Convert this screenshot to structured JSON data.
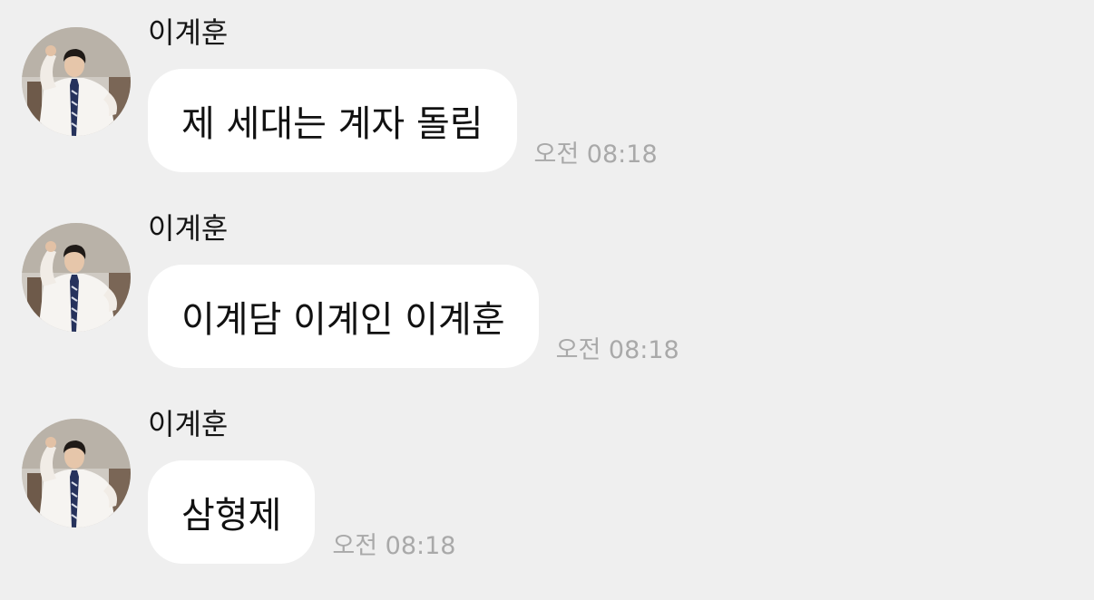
{
  "chat": {
    "messages": [
      {
        "sender": "이계훈",
        "text": "제 세대는 계자 돌림",
        "time": "오전 08:18"
      },
      {
        "sender": "이계훈",
        "text": "이계담 이계인 이계훈",
        "time": "오전 08:18"
      },
      {
        "sender": "이계훈",
        "text": "삼형제",
        "time": "오전 08:18"
      }
    ]
  },
  "colors": {
    "background": "#efefef",
    "bubble": "#ffffff",
    "sender_text": "#141414",
    "message_text": "#111111",
    "timestamp": "#a9a9a9"
  }
}
